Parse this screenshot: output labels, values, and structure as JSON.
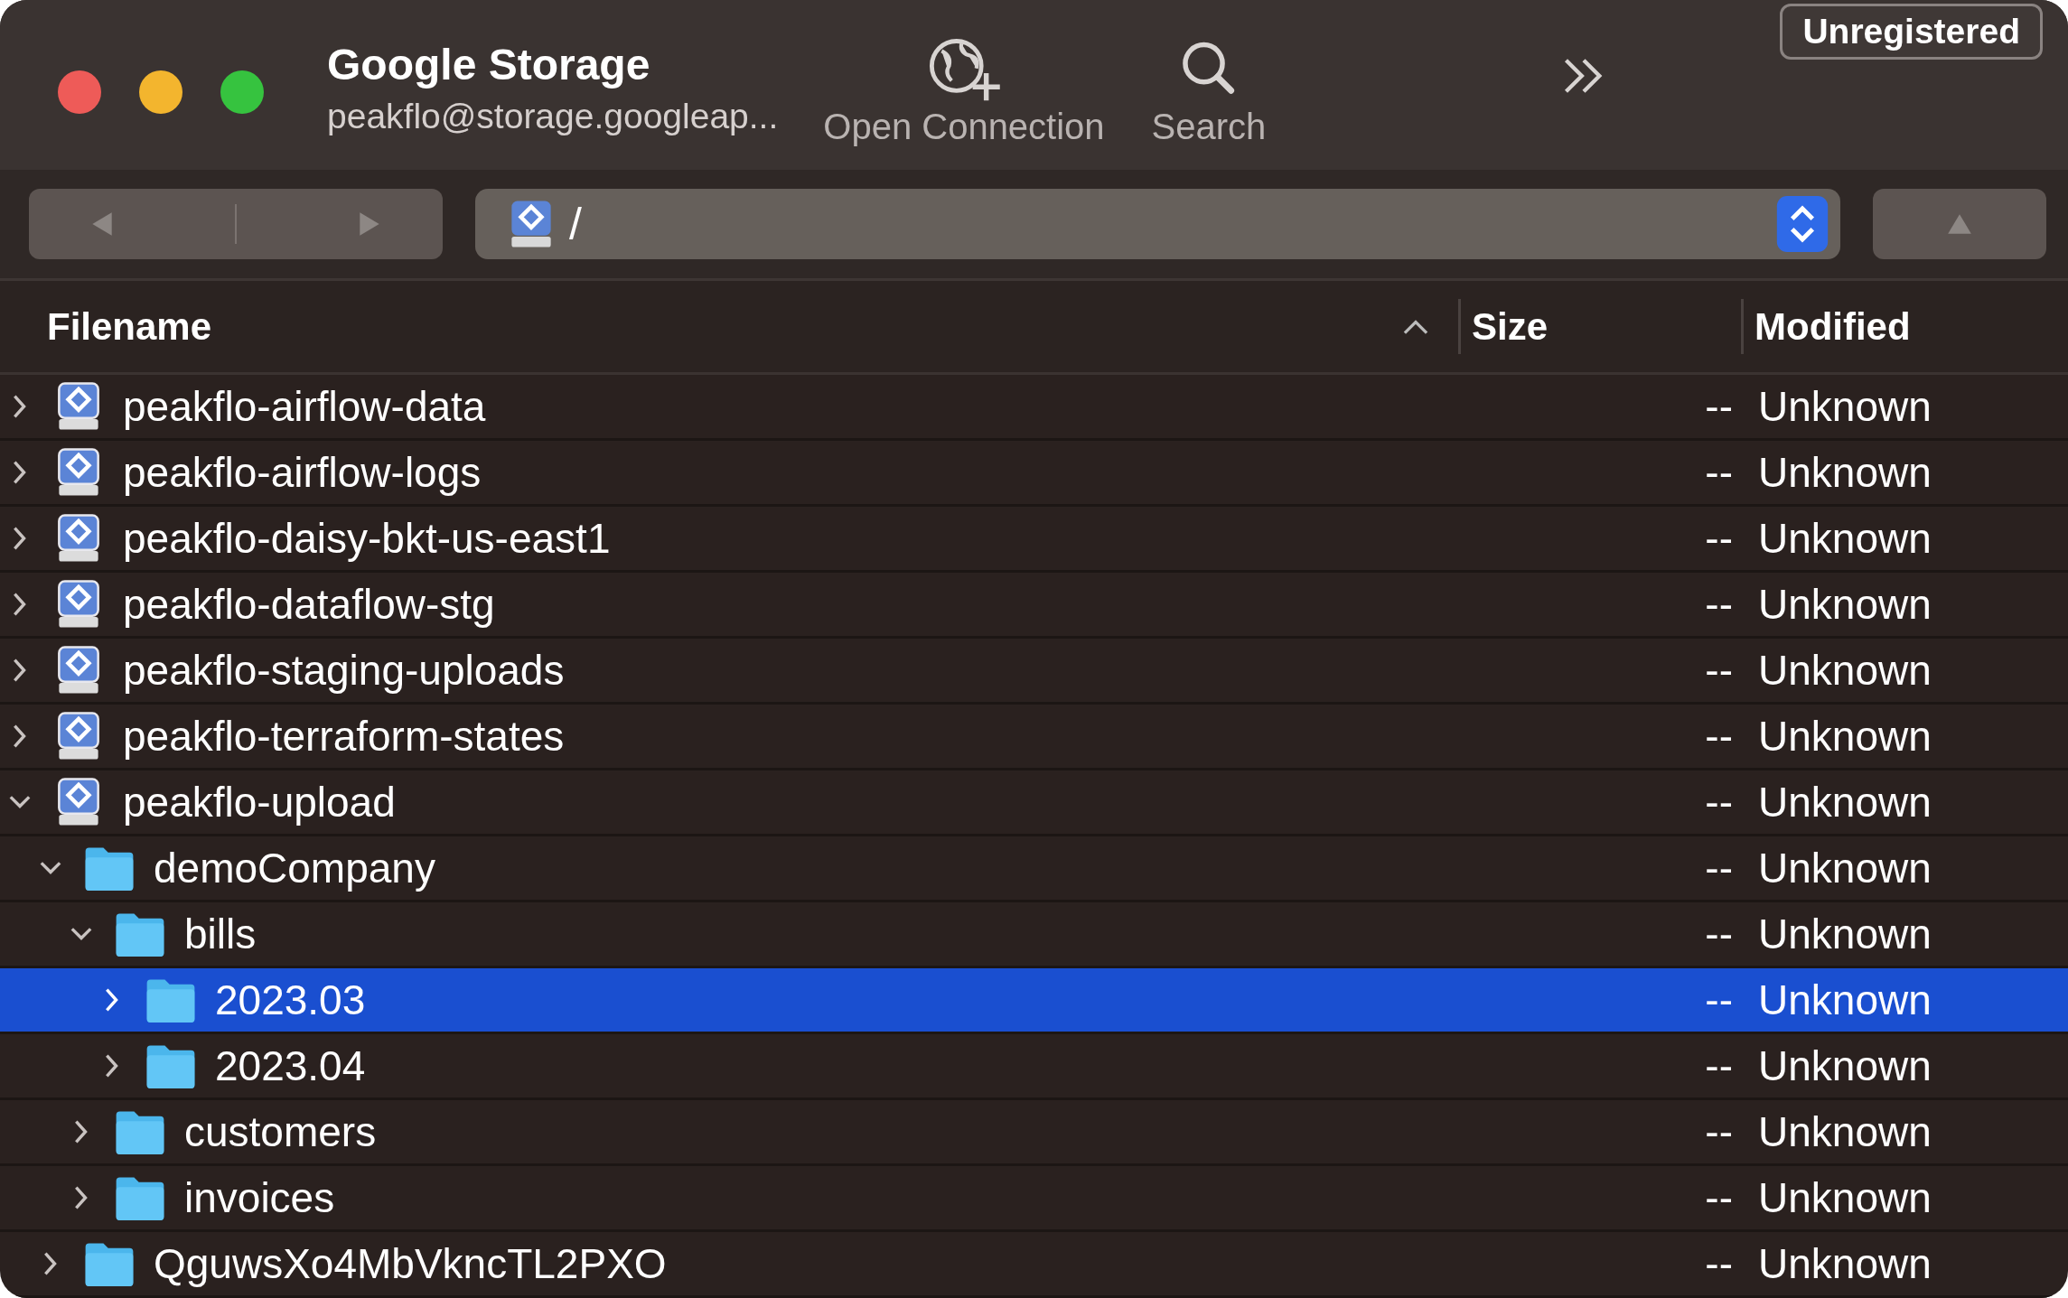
{
  "window": {
    "title": "Google Storage",
    "subtitle": "peakflo@storage.googleap..."
  },
  "toolbar": [
    {
      "label": "Open Connection",
      "kind": "connection"
    },
    {
      "label": "Search",
      "kind": "search"
    }
  ],
  "badge": "Unregistered",
  "path": "/",
  "columns": [
    {
      "label": "Filename",
      "sorted": true
    },
    {
      "label": "Size",
      "sorted": false
    },
    {
      "label": "Modified",
      "sorted": false
    }
  ],
  "rows": [
    {
      "name": "peakflo-airflow-data",
      "kind": "bucket",
      "size": "--",
      "modified": "Unknown",
      "expanded": false,
      "selected": false
    },
    {
      "name": "peakflo-airflow-logs",
      "kind": "bucket",
      "size": "--",
      "modified": "Unknown",
      "expanded": false,
      "selected": false
    },
    {
      "name": "peakflo-daisy-bkt-us-east1",
      "kind": "bucket",
      "size": "--",
      "modified": "Unknown",
      "expanded": false,
      "selected": false
    },
    {
      "name": "peakflo-dataflow-stg",
      "kind": "bucket",
      "size": "--",
      "modified": "Unknown",
      "expanded": false,
      "selected": false
    },
    {
      "name": "peakflo-staging-uploads",
      "kind": "bucket",
      "size": "--",
      "modified": "Unknown",
      "expanded": false,
      "selected": false
    },
    {
      "name": "peakflo-terraform-states",
      "kind": "bucket",
      "size": "--",
      "modified": "Unknown",
      "expanded": false,
      "selected": false
    },
    {
      "name": "peakflo-upload",
      "kind": "bucket",
      "size": "--",
      "modified": "Unknown",
      "expanded": true,
      "selected": false,
      "children": [
        {
          "name": "demoCompany",
          "kind": "folder",
          "size": "--",
          "modified": "Unknown",
          "expanded": true,
          "selected": false,
          "children": [
            {
              "name": "bills",
              "kind": "folder",
              "size": "--",
              "modified": "Unknown",
              "expanded": true,
              "selected": false,
              "children": [
                {
                  "name": "2023.03",
                  "kind": "folder",
                  "size": "--",
                  "modified": "Unknown",
                  "expanded": false,
                  "selected": true
                },
                {
                  "name": "2023.04",
                  "kind": "folder",
                  "size": "--",
                  "modified": "Unknown",
                  "expanded": false,
                  "selected": false
                }
              ]
            },
            {
              "name": "customers",
              "kind": "folder",
              "size": "--",
              "modified": "Unknown",
              "expanded": false,
              "selected": false
            },
            {
              "name": "invoices",
              "kind": "folder",
              "size": "--",
              "modified": "Unknown",
              "expanded": false,
              "selected": false
            }
          ]
        },
        {
          "name": "QguwsXo4MbVkncTL2PXO",
          "kind": "folder",
          "size": "--",
          "modified": "Unknown",
          "expanded": false,
          "selected": false
        }
      ]
    }
  ]
}
